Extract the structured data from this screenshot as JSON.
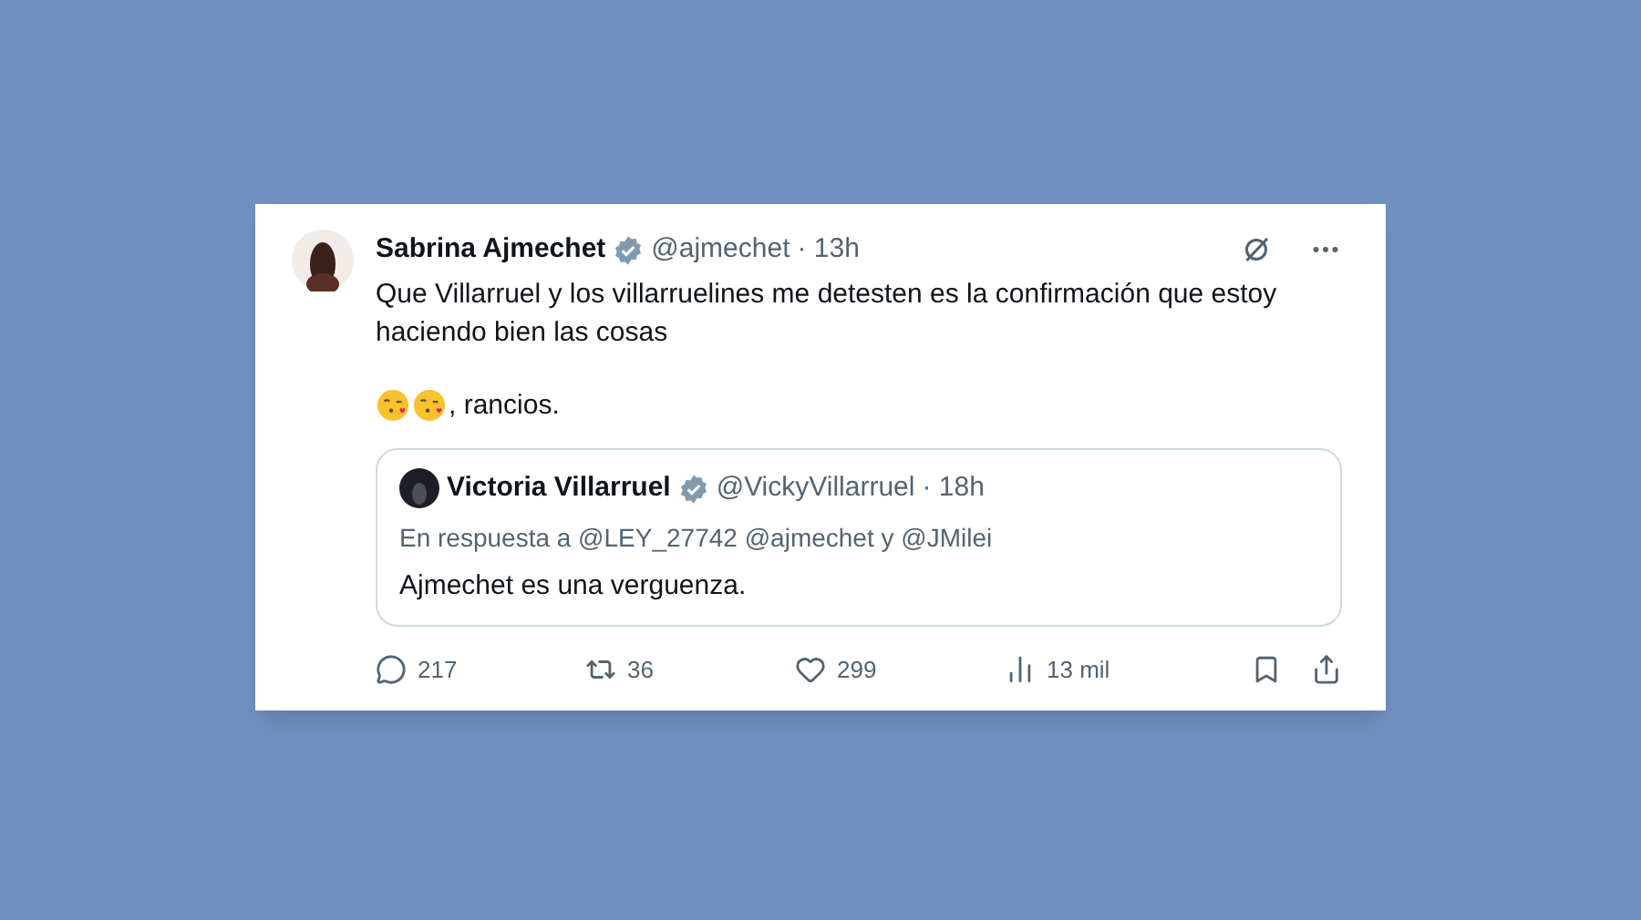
{
  "tweet": {
    "name": "Sabrina Ajmechet",
    "handle": "@ajmechet",
    "time": "· 13h",
    "verified": true,
    "text": "Que Villarruel y los villarruelines me detesten es la confirmación que estoy haciendo bien las cosas",
    "text_2": ", rancios.",
    "quote": {
      "name": "Victoria Villarruel",
      "handle": "@VickyVillarruel",
      "time": "· 18h",
      "verified": true,
      "reply_to": "En respuesta a @LEY_27742 @ajmechet y @JMilei",
      "text": "Ajmechet es una verguenza."
    },
    "stats": [
      {
        "kind": "reply",
        "count": "217"
      },
      {
        "kind": "retweet",
        "count": "36"
      },
      {
        "kind": "like",
        "count": "299"
      },
      {
        "kind": "views",
        "count": "13 mil"
      }
    ]
  }
}
